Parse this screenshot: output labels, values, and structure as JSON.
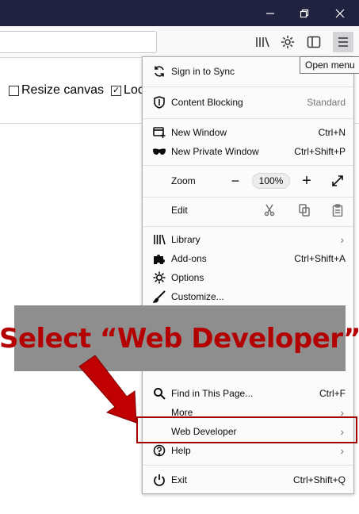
{
  "window_controls": {
    "minimize_glyph": "—",
    "restore_glyph": "❐",
    "close_glyph": "✕"
  },
  "tooltip": "Open menu",
  "page": {
    "resize_canvas_label": "Resize canvas",
    "lock_label": "Loc",
    "resize_checked": false,
    "lock_checked": true
  },
  "menu": {
    "sign_in": "Sign in to Sync",
    "content_blocking": "Content Blocking",
    "content_blocking_value": "Standard",
    "new_window": "New Window",
    "new_window_shortcut": "Ctrl+N",
    "new_private_window": "New Private Window",
    "new_private_window_shortcut": "Ctrl+Shift+P",
    "zoom": "Zoom",
    "zoom_minus": "−",
    "zoom_value": "100%",
    "zoom_plus": "+",
    "edit": "Edit",
    "library": "Library",
    "addons": "Add-ons",
    "addons_shortcut": "Ctrl+Shift+A",
    "options": "Options",
    "customize": "Customize...",
    "find_in_page": "Find in This Page...",
    "find_shortcut": "Ctrl+F",
    "more": "More",
    "web_developer": "Web Developer",
    "help": "Help",
    "exit": "Exit",
    "exit_shortcut": "Ctrl+Shift+Q",
    "chevron": "›"
  },
  "annotation": {
    "text": "Select “Web Developer”",
    "color": "#b30000"
  }
}
